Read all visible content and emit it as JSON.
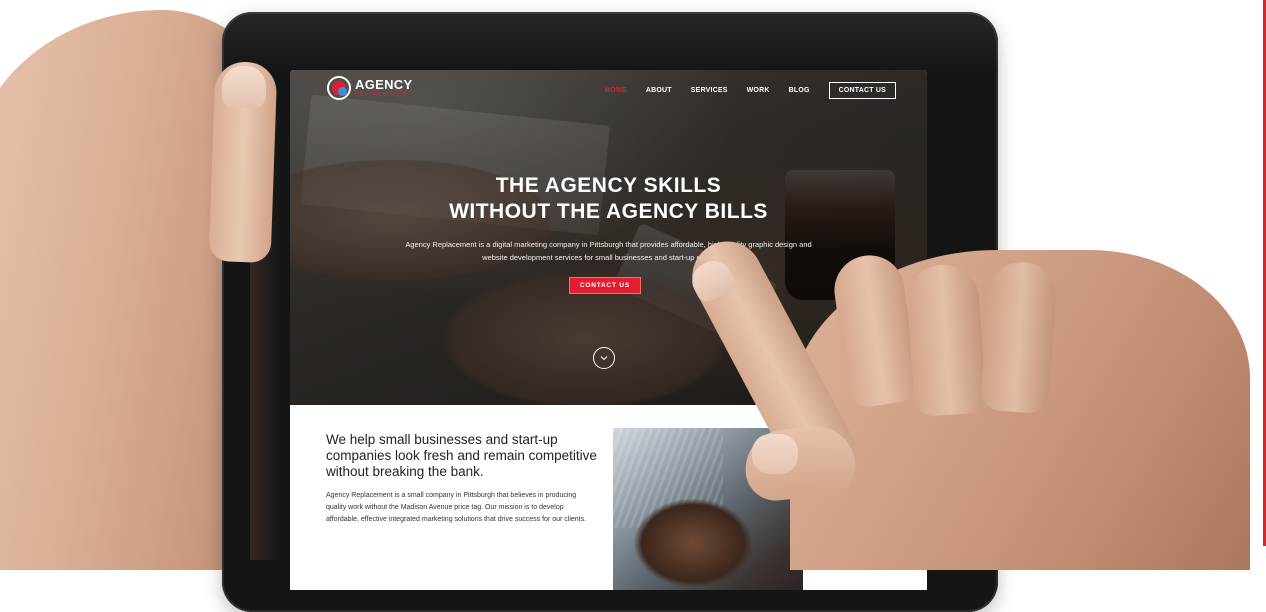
{
  "colors": {
    "accent": "#e21f32",
    "logo_blue": "#3a8fd6"
  },
  "logo": {
    "name": "AGENCY",
    "tagline": "REPLACEMENT"
  },
  "nav": {
    "items": [
      {
        "label": "HOME",
        "active": true
      },
      {
        "label": "ABOUT",
        "active": false
      },
      {
        "label": "SERVICES",
        "active": false
      },
      {
        "label": "WORK",
        "active": false
      },
      {
        "label": "BLOG",
        "active": false
      }
    ],
    "cta_label": "CONTACT US"
  },
  "hero": {
    "title_line1": "THE AGENCY SKILLS",
    "title_line2": "WITHOUT THE AGENCY BILLS",
    "description": "Agency Replacement is a digital marketing company in Pittsburgh that provides affordable, high-quality graphic design and website development services for small businesses and start-up companies.",
    "button_label": "CONTACT US",
    "scroll_icon": "chevron-down-icon"
  },
  "intro": {
    "heading": "We help small businesses and start-up companies look fresh and remain competitive without breaking the bank.",
    "body": "Agency Replacement is a small company in Pittsburgh that believes in producing quality work without the Madison Avenue price tag. Our mission is to develop affordable, effective integrated marketing solutions that drive success for our clients."
  }
}
